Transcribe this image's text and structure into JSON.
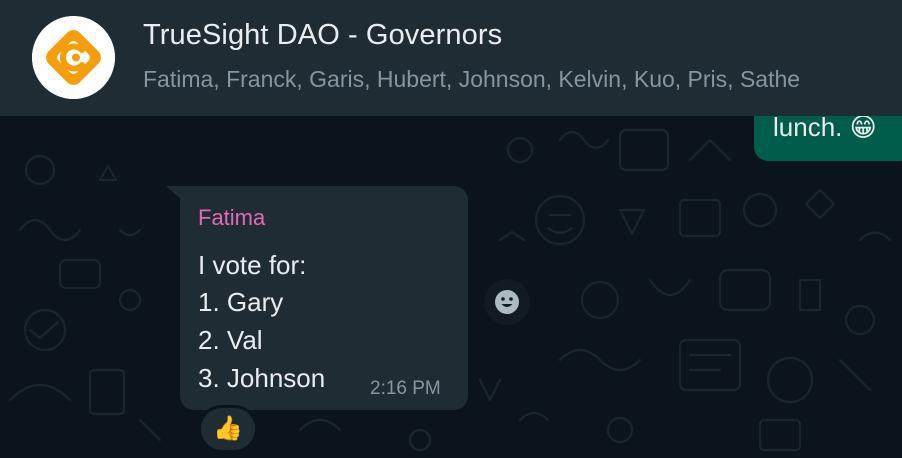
{
  "header": {
    "title": "TrueSight DAO - Governors",
    "members": "Fatima, Franck, Garis, Hubert, Johnson, Kelvin, Kuo, Pris, Sathe",
    "avatar_icon": "truesight-logo-icon",
    "avatar_color": "#f59e0b"
  },
  "sent_message": {
    "text": "lunch. 😁"
  },
  "message": {
    "sender": "Fatima",
    "lines": [
      "I vote for:",
      "1. Gary",
      "2. Val",
      "3. Johnson"
    ],
    "time": "2:16 PM",
    "reaction": "👍",
    "reaction_button_icon": "smiley-icon"
  },
  "colors": {
    "background": "#0b141a",
    "header": "#202c33",
    "incoming_bubble": "#202c33",
    "outgoing_bubble": "#005c4b",
    "sender_name": "#e26ab6",
    "text_primary": "#e9edef",
    "text_secondary": "#8696a0"
  }
}
